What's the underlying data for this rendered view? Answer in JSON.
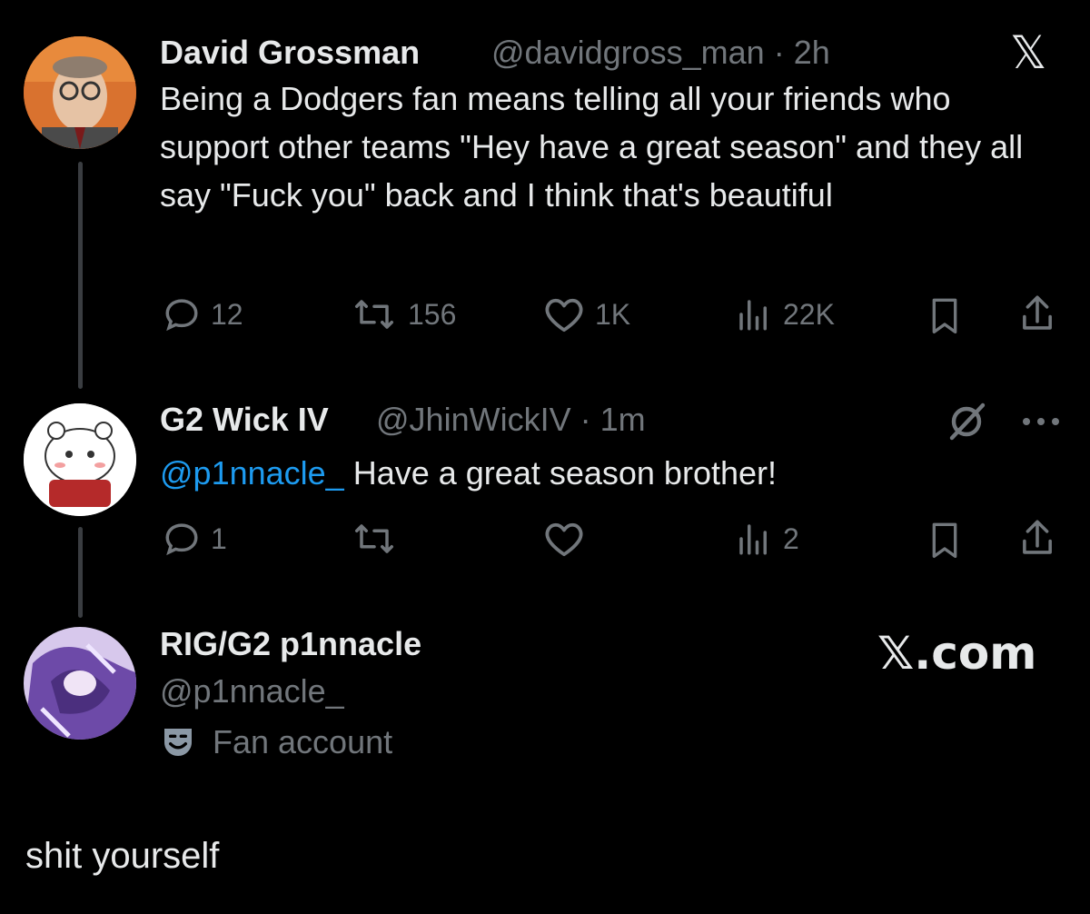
{
  "tweet1": {
    "name": "David Grossman",
    "handle": "@davidgross_man",
    "time": "· 2h",
    "text": "Being a Dodgers fan means telling all your friends who support other teams \"Hey have a great season\" and they all say \"Fuck you\" back and I think that's beautiful",
    "replies": "12",
    "reposts": "156",
    "likes": "1K",
    "views": "22K"
  },
  "tweet2": {
    "name": "G2 Wick IV",
    "handle": "@JhinWickIV",
    "time": "· 1m",
    "mention": "@p1nnacle_",
    "text": "Have a great season brother!",
    "replies": "1",
    "views": "2"
  },
  "profile": {
    "name": "RIG/G2 p1nnacle",
    "handle": "@p1nnacle_",
    "badge": "Fan account"
  },
  "brand": {
    "x_logo": "𝕏",
    "x_com": "𝕏.com"
  },
  "caption": "shit yourself",
  "icons": [
    "reply-icon",
    "repost-icon",
    "like-icon",
    "views-icon",
    "bookmark-icon",
    "share-icon",
    "grok-icon",
    "more-icon",
    "x-logo-icon",
    "theater-masks-icon"
  ],
  "colors": {
    "background": "#000000",
    "text": "#e7e9ea",
    "muted": "#71767b",
    "accent": "#1d9bf0"
  }
}
